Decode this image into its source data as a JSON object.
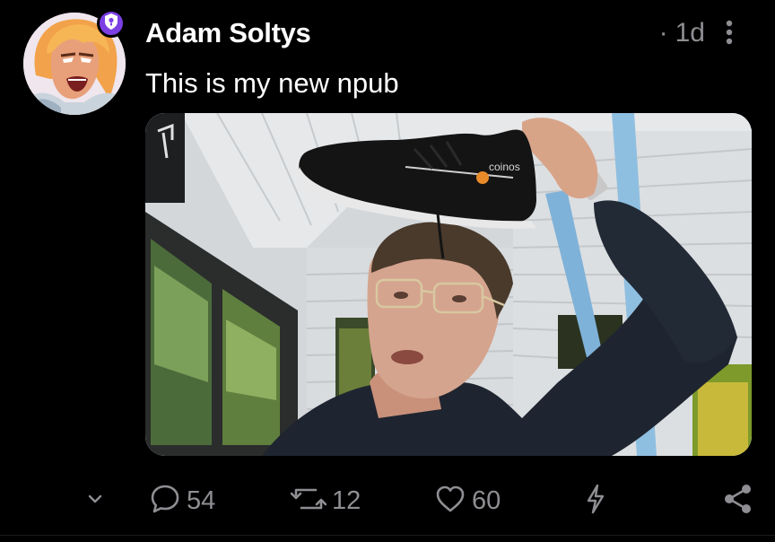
{
  "post": {
    "author_name": "Adam Soltys",
    "timestamp": "1d",
    "text": "This is my new npub",
    "avatar_icon": "he-man-avatar",
    "badge_icon": "verified-shield-icon",
    "media_alt": "",
    "shoe_brand_text": "coinos"
  },
  "actions": {
    "replies_count": "54",
    "reposts_count": "12",
    "likes_count": "60"
  },
  "colors": {
    "background": "#000000",
    "text_primary": "#ffffff",
    "text_secondary": "#8e8e93",
    "badge_accent": "#7b3fe4"
  }
}
